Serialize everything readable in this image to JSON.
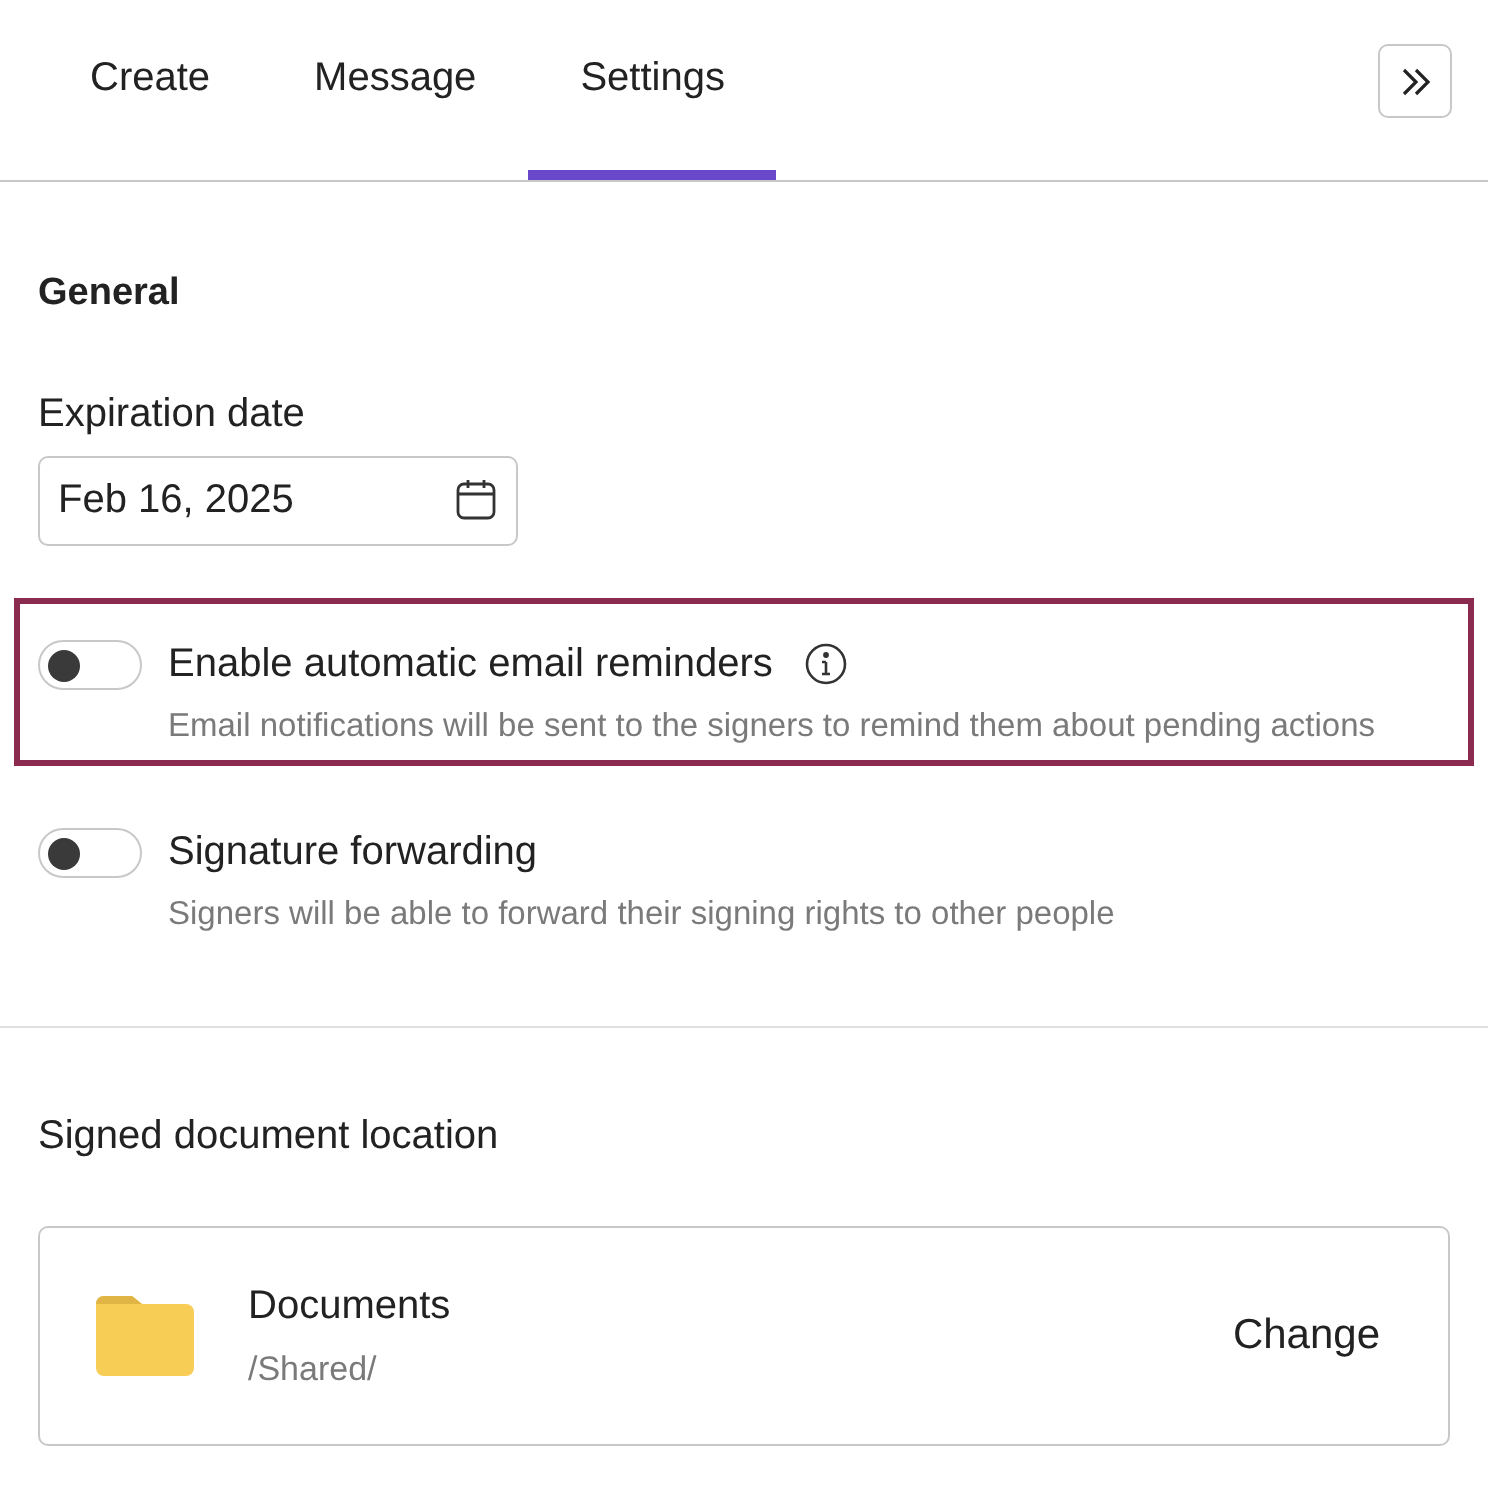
{
  "tabs": [
    {
      "label": "Create",
      "selected": false
    },
    {
      "label": "Message",
      "selected": false
    },
    {
      "label": "Settings",
      "selected": true
    }
  ],
  "general": {
    "heading": "General",
    "expiration_label": "Expiration date",
    "expiration_value": "Feb 16, 2025"
  },
  "options": [
    {
      "title": "Enable automatic email reminders",
      "description": "Email notifications will be sent to the signers to remind them about pending actions",
      "on": false,
      "highlighted": true,
      "info": true
    },
    {
      "title": "Signature forwarding",
      "description": "Signers will be able to forward their signing rights to other people",
      "on": false,
      "highlighted": false,
      "info": false
    }
  ],
  "location": {
    "heading": "Signed document location",
    "folder": "Documents",
    "path": "/Shared/",
    "action": "Change"
  }
}
